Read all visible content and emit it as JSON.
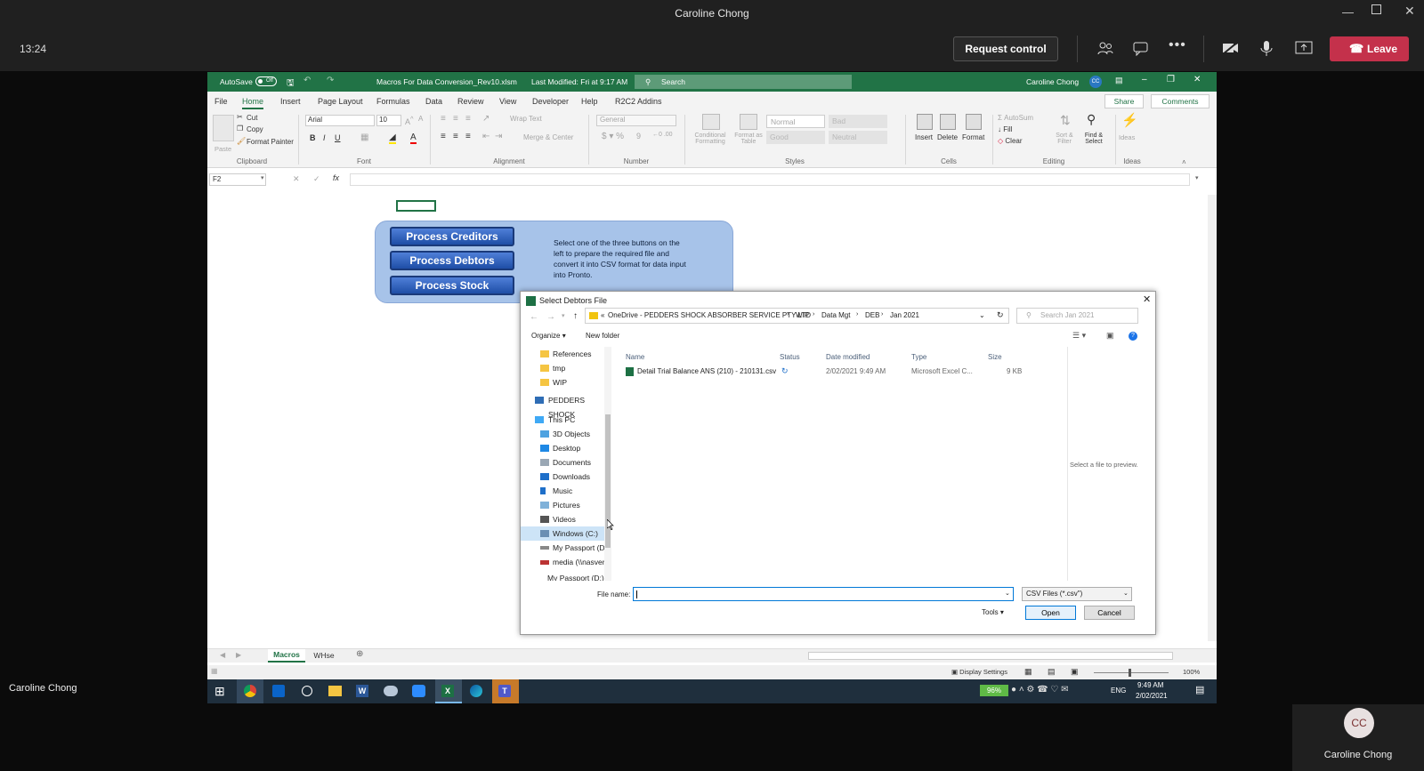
{
  "teams": {
    "window_title": "Caroline Chong",
    "clock": "13:24",
    "request_control": "Request control",
    "leave": "Leave",
    "presenter_label": "Caroline Chong",
    "participant_initials": "CC",
    "participant_name": "Caroline Chong"
  },
  "excel": {
    "autosave": "AutoSave",
    "autosave_state": "Off",
    "filename": "Macros For Data Conversion_Rev10.xlsm",
    "modified": "Last Modified: Fri at 9:17 AM",
    "search": "Search",
    "user": "Caroline Chong",
    "user_initials": "CC",
    "tabs": [
      "File",
      "Home",
      "Insert",
      "Page Layout",
      "Formulas",
      "Data",
      "Review",
      "View",
      "Developer",
      "Help",
      "R2C2 Addins"
    ],
    "share": "Share",
    "comments": "Comments",
    "clipboard": {
      "paste": "Paste",
      "cut": "Cut",
      "copy": "Copy",
      "format_painter": "Format Painter",
      "group": "Clipboard"
    },
    "font": {
      "name": "Arial",
      "size": "10",
      "group": "Font"
    },
    "alignment": {
      "wrap": "Wrap Text",
      "merge": "Merge & Center",
      "group": "Alignment"
    },
    "number": {
      "format": "General",
      "group": "Number"
    },
    "styles": {
      "cond": "Conditional Formatting",
      "table": "Format as Table",
      "normal": "Normal",
      "bad": "Bad",
      "good": "Good",
      "neutral": "Neutral",
      "group": "Styles"
    },
    "cells": {
      "insert": "Insert",
      "delete": "Delete",
      "format": "Format",
      "group": "Cells"
    },
    "editing": {
      "autosum": "AutoSum",
      "fill": "Fill",
      "clear": "Clear",
      "sort": "Sort & Filter",
      "find": "Find & Select",
      "group": "Editing"
    },
    "ideas": {
      "label": "Ideas",
      "group": "Ideas"
    },
    "namebox": "F2",
    "buttons": [
      "Process Creditors",
      "Process Debtors",
      "Process Stock"
    ],
    "instructions": "Select one of the three buttons on the left to prepare the required file and convert it into CSV format for data input into Pronto.",
    "sheets": [
      "Macros",
      "WHse"
    ],
    "display_settings": "Display Settings",
    "zoom": "100%"
  },
  "dialog": {
    "title": "Select Debtors File",
    "breadcrumb": [
      "OneDrive - PEDDERS SHOCK ABSORBER SERVICE PTY LTD",
      "WIP",
      "Data Mgt",
      "DEB",
      "Jan 2021"
    ],
    "search_placeholder": "Search Jan 2021",
    "organize": "Organize",
    "new_folder": "New folder",
    "nav": [
      "References",
      "tmp",
      "WIP",
      "PEDDERS SHOCK",
      "This PC",
      "3D Objects",
      "Desktop",
      "Documents",
      "Downloads",
      "Music",
      "Pictures",
      "Videos",
      "Windows (C:)",
      "My Passport (D:)",
      "media (\\\\nasver",
      "My Passport (D:)"
    ],
    "columns": [
      "Name",
      "Status",
      "Date modified",
      "Type",
      "Size"
    ],
    "files": [
      {
        "name": "Detail Trial Balance ANS (210) - 210131.csv",
        "date": "2/02/2021 9:49 AM",
        "type": "Microsoft Excel C...",
        "size": "9 KB"
      }
    ],
    "preview": "Select a file to preview.",
    "filename_label": "File name:",
    "filter": "CSV Files (*.csv\")",
    "tools": "Tools",
    "open": "Open",
    "cancel": "Cancel"
  },
  "taskbar": {
    "battery": "96%",
    "lang": "ENG",
    "time": "9:49 AM",
    "date": "2/02/2021"
  }
}
